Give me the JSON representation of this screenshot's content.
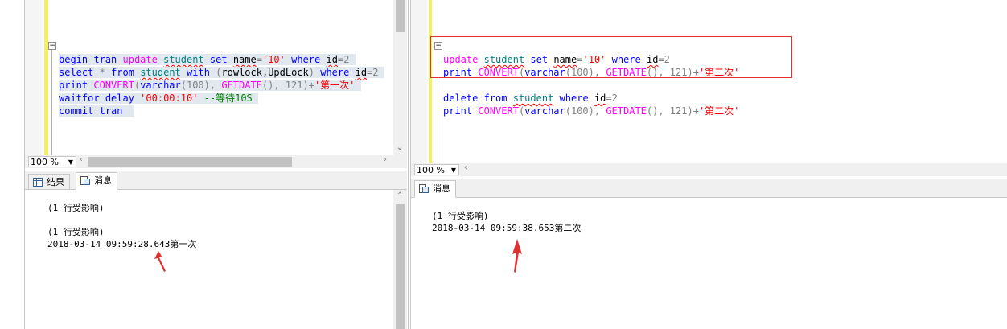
{
  "left": {
    "code": {
      "line1": {
        "begin": "begin",
        "tran": "tran",
        "update": "update",
        "table": "student",
        "set": "set",
        "col": "name",
        "eq": "=",
        "val": "'10'",
        "where": "where",
        "id": "id",
        "eq2": "=2"
      },
      "line2": {
        "select": "select",
        "star": "*",
        "from": "from",
        "table": "student",
        "with": "with",
        "hint_open": "(",
        "hint": "rowlock,UpdLock",
        "hint_close": ")",
        "where": "where",
        "id": "id",
        "eq": "=2"
      },
      "line3": {
        "print": "print",
        "convert": "CONVERT",
        "open": "(",
        "varchar": "varchar",
        "args1": "(100), ",
        "getdate": "GETDATE",
        "args2": "(), 121)",
        "plus": "+",
        "str": "'第一次'"
      },
      "line4": {
        "waitfor": "waitfor",
        "delay": "delay",
        "str": "'00:00:10'",
        "comment": "--等待10S"
      },
      "line5": {
        "commit": "commit",
        "tran": "tran"
      }
    },
    "zoom": "100 %",
    "tabs": {
      "results": "结果",
      "messages": "消息"
    },
    "messages": [
      "(1 行受影响)",
      "(1 行受影响)",
      "2018-03-14 09:59:28.643第一次"
    ]
  },
  "right": {
    "code": {
      "line1": {
        "update": "update",
        "table": "student",
        "set": "set",
        "col": "name",
        "eq": "=",
        "val": "'10'",
        "where": "where",
        "id": "id",
        "eq2": "=2"
      },
      "line2": {
        "print": "print",
        "convert": "CONVERT",
        "open": "(",
        "varchar": "varchar",
        "args1": "(100), ",
        "getdate": "GETDATE",
        "args2": "(), 121)",
        "plus": "+",
        "str": "'第二次'"
      },
      "line3": {
        "delete": "delete",
        "from": "from",
        "table": "student",
        "where": "where",
        "id": "id",
        "eq": "=2"
      },
      "line4": {
        "print": "print",
        "convert": "CONVERT",
        "open": "(",
        "varchar": "varchar",
        "args1": "(100), ",
        "getdate": "GETDATE",
        "args2": "(), 121)",
        "plus": "+",
        "str": "'第二次'"
      }
    },
    "zoom": "100 %",
    "tabs": {
      "messages": "消息"
    },
    "messages": [
      "(1 行受影响)",
      "2018-03-14 09:59:38.653第二次"
    ]
  },
  "colors": {
    "keyword": "#0000ff",
    "function": "#ff00ff",
    "string": "#ff0000",
    "comment": "#008000",
    "table": "#008080",
    "highlight_box": "#e03030",
    "arrow": "#e03030"
  }
}
